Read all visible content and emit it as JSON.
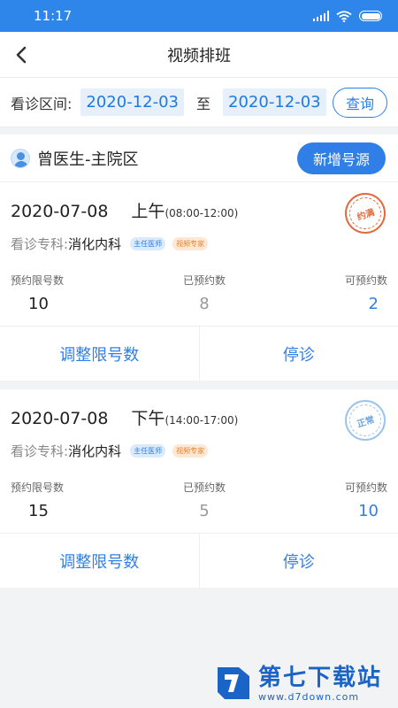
{
  "status": {
    "time": "11:17"
  },
  "nav": {
    "title": "视频排班"
  },
  "filter": {
    "label": "看诊区间:",
    "start_date": "2020-12-03",
    "separator": "至",
    "end_date": "2020-12-03",
    "query_label": "查询"
  },
  "doctor": {
    "name": "曾医生-主院区",
    "add_label": "新增号源"
  },
  "schedules": [
    {
      "date": "2020-07-08",
      "period": "上午",
      "time_range": "(08:00-12:00)",
      "dept_label": "看诊专科:",
      "dept_name": "消化内科",
      "tags": [
        "主任医师",
        "视频专家"
      ],
      "stats": [
        {
          "label": "预约限号数",
          "value": "10"
        },
        {
          "label": "已预约数",
          "value": "8"
        },
        {
          "label": "可预约数",
          "value": "2"
        }
      ],
      "stamp_text": "约满",
      "stamp_color": "#e06a3b",
      "actions": [
        "调整限号数",
        "停诊"
      ]
    },
    {
      "date": "2020-07-08",
      "period": "下午",
      "time_range": "(14:00-17:00)",
      "dept_label": "看诊专科:",
      "dept_name": "消化内科",
      "tags": [
        "主任医师",
        "视频专家"
      ],
      "stats": [
        {
          "label": "预约限号数",
          "value": "15"
        },
        {
          "label": "已预约数",
          "value": "5"
        },
        {
          "label": "可预约数",
          "value": "10"
        }
      ],
      "stamp_text": "正常",
      "stamp_color": "#6aa4de",
      "actions": [
        "调整限号数",
        "停诊"
      ]
    }
  ],
  "watermark": {
    "title": "第七下载站",
    "url": "www.d7down.com"
  },
  "colors": {
    "primary": "#2f7fe6",
    "status_bar": "#2f86ea",
    "warning": "#e06a3b"
  }
}
